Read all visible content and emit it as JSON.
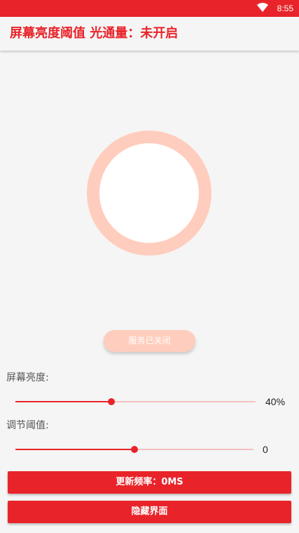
{
  "status_bar": {
    "time": "8:55",
    "icons": [
      "wifi-icon"
    ],
    "color": "#e8242a"
  },
  "app_bar": {
    "title": "屏幕亮度阈值 光通量：未开启",
    "title_color": "#e8242a"
  },
  "indicator": {
    "ring_color": "#ffcdbd"
  },
  "service_button": {
    "label": "服务已关闭"
  },
  "brightness": {
    "label": "屏幕亮度:",
    "value_text": "40%",
    "fraction": 0.4
  },
  "threshold": {
    "label": "调节阈值:",
    "value_text": "0",
    "fraction": 0.5
  },
  "buttons": {
    "refresh_rate": "更新频率：0MS",
    "hide_ui": "隐藏界面"
  }
}
